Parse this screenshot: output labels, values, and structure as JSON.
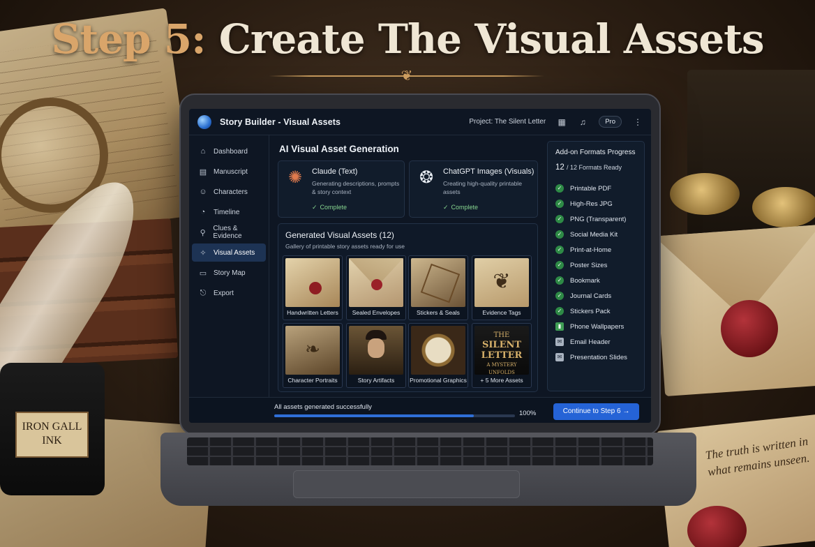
{
  "headline": {
    "step": "Step 5:",
    "title": "Create The Visual Assets"
  },
  "props": {
    "ink_label_line1": "IRON GALL",
    "ink_label_line2": "INK",
    "note_text": "The truth is written in what remains unseen."
  },
  "app": {
    "title": "Story Builder - Visual Assets",
    "project": "Project: The Silent Letter",
    "plan_badge": "Pro",
    "icons": [
      "calendar-icon",
      "bell-icon",
      "more-vertical-icon"
    ]
  },
  "sidebar": {
    "items": [
      {
        "label": "Dashboard",
        "icon": "home-icon",
        "glyph": "⌂"
      },
      {
        "label": "Manuscript",
        "icon": "document-icon",
        "glyph": "▤"
      },
      {
        "label": "Characters",
        "icon": "person-icon",
        "glyph": "☺"
      },
      {
        "label": "Timeline",
        "icon": "timeline-icon",
        "glyph": "◔"
      },
      {
        "label": "Clues & Evidence",
        "icon": "search-icon",
        "glyph": "⚲"
      },
      {
        "label": "Visual Assets",
        "icon": "sparkle-icon",
        "glyph": "✧",
        "active": true
      },
      {
        "label": "Story Map",
        "icon": "map-icon",
        "glyph": "▭"
      },
      {
        "label": "Export",
        "icon": "export-icon",
        "glyph": "⎋"
      }
    ]
  },
  "main": {
    "section_title": "AI Visual Asset Generation",
    "generators": [
      {
        "name": "Claude (Text)",
        "desc": "Generating descriptions, prompts & story context",
        "status": "Complete",
        "icon": "claude-icon"
      },
      {
        "name": "ChatGPT Images (Visuals)",
        "desc": "Creating high-quality printable assets",
        "status": "Complete",
        "icon": "openai-icon"
      }
    ],
    "gallery": {
      "title": "Generated Visual Assets (12)",
      "subtitle": "Gallery of printable story assets ready for use",
      "tiles": [
        {
          "label": "Handwritten Letters"
        },
        {
          "label": "Sealed Envelopes"
        },
        {
          "label": "Stickers & Seals"
        },
        {
          "label": "Evidence Tags"
        },
        {
          "label": "Character Portraits"
        },
        {
          "label": "Story Artifacts"
        },
        {
          "label": "Promotional Graphics"
        },
        {
          "label": "+ 5 More Assets"
        }
      ],
      "book_cover": {
        "line1": "THE",
        "line2": "SILENT",
        "line3": "LETTER",
        "line4": "A MYSTERY",
        "line5": "UNFOLDS"
      }
    }
  },
  "formats": {
    "title": "Add-on Formats Progress",
    "count": "12",
    "count_label": "/  12 Formats Ready",
    "items": [
      {
        "label": "Printable PDF",
        "icon": "check-circle-icon"
      },
      {
        "label": "High-Res JPG",
        "icon": "check-circle-icon"
      },
      {
        "label": "PNG (Transparent)",
        "icon": "check-circle-icon"
      },
      {
        "label": "Social Media Kit",
        "icon": "check-circle-icon"
      },
      {
        "label": "Print-at-Home",
        "icon": "check-circle-icon"
      },
      {
        "label": "Poster Sizes",
        "icon": "check-circle-icon"
      },
      {
        "label": "Bookmark",
        "icon": "check-circle-icon"
      },
      {
        "label": "Journal Cards",
        "icon": "check-circle-icon"
      },
      {
        "label": "Stickers Pack",
        "icon": "check-circle-icon"
      },
      {
        "label": "Phone Wallpapers",
        "icon": "phone-icon"
      },
      {
        "label": "Email Header",
        "icon": "mail-icon"
      },
      {
        "label": "Presentation Slides",
        "icon": "mail-icon"
      }
    ]
  },
  "footer": {
    "status": "All assets generated successfully",
    "progress_percent": 100,
    "progress_label": "100%",
    "button_label": "Continue to Step 6",
    "button_arrow": "→"
  },
  "colors": {
    "accent": "#2563d6",
    "success": "#86d48f",
    "headline_gold": "#d9a56a"
  }
}
